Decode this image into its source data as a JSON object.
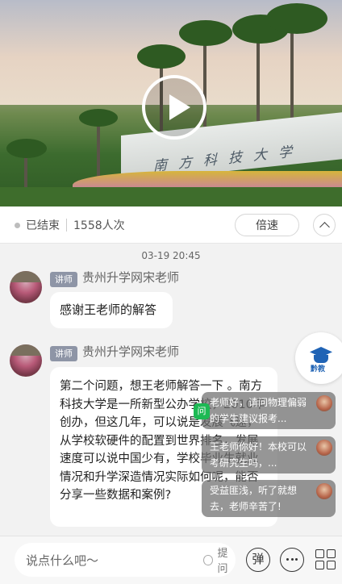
{
  "video": {
    "sign_text": "南方科技大学"
  },
  "status": {
    "ended_label": "已结束",
    "viewers": "1558人次",
    "speed_label": "倍速"
  },
  "chat": {
    "timestamp": "03-19 20:45",
    "messages": [
      {
        "role_tag": "讲师",
        "sender": "贵州升学网宋老师",
        "text": "感谢王老师的解答"
      },
      {
        "role_tag": "讲师",
        "sender": "贵州升学网宋老师",
        "text": "第二个问题，想王老师解答一下 。南方科技大学是一所新型公办学校，2010年创办，但这几年，可以说是发展飞速，从学校软硬件的配置到世界排名，发展速度可以说中国少有，学校毕业生就业情况和升学深造情况实际如何呢，能否分享一些数据和案例?"
      }
    ]
  },
  "floating_qa": {
    "badge": "问",
    "items": [
      {
        "text": "老师好，请问物理偏弱的学生建议报考..."
      },
      {
        "text": "王老师你好！本校可以考研究生吗，..."
      },
      {
        "text": "受益匪浅，听了就想去，老师辛苦了!"
      }
    ]
  },
  "brand_badge": {
    "label": "黔教"
  },
  "composer": {
    "placeholder": "说点什么吧～",
    "ask_label": "提问",
    "barrage_label": "弹"
  }
}
